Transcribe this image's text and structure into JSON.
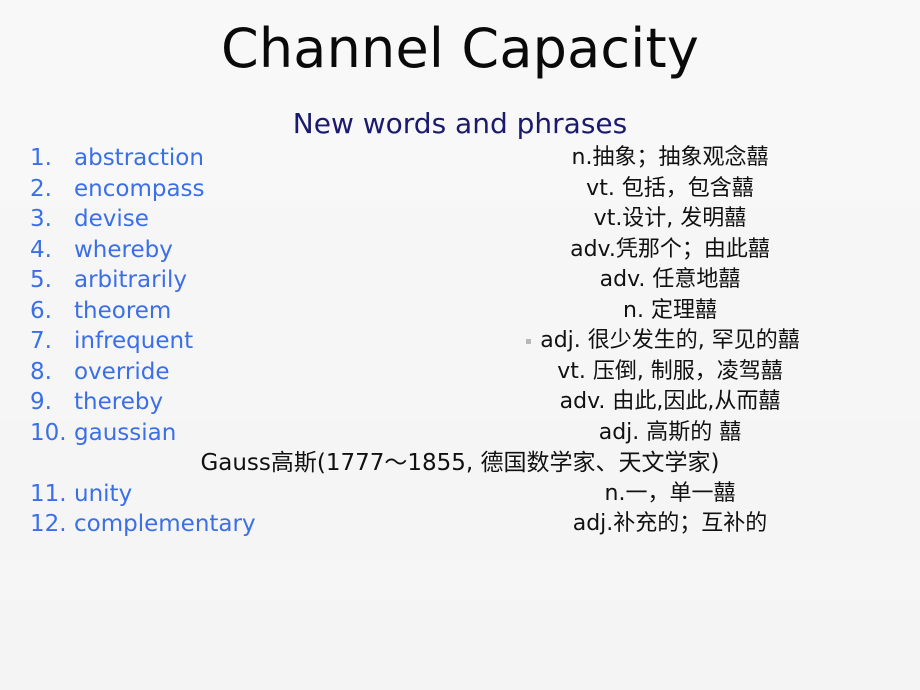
{
  "slide": {
    "title": "Channel Capacity",
    "subtitle": "New words and phrases",
    "title_color": "#0a0a0a",
    "subtitle_color": "#1a1a6e",
    "word_color": "#3b6fe8",
    "definition_color": "#111111",
    "background_color": "#f6f6f6"
  },
  "vocabulary": [
    {
      "num": "1.",
      "word": "abstraction",
      "definition": "n.抽象；抽象观念囍",
      "bullet": false
    },
    {
      "num": "2.",
      "word": "encompass",
      "definition": "vt. 包括，包含囍",
      "bullet": false
    },
    {
      "num": "3.",
      "word": "devise",
      "definition": "vt.设计, 发明囍",
      "bullet": false
    },
    {
      "num": "4.",
      "word": "whereby",
      "definition": "adv.凭那个；由此囍",
      "bullet": false
    },
    {
      "num": "5.",
      "word": "arbitrarily",
      "definition": "adv. 任意地囍",
      "bullet": false
    },
    {
      "num": "6.",
      "word": "theorem",
      "definition": "n. 定理囍",
      "bullet": false
    },
    {
      "num": "7.",
      "word": "infrequent",
      "definition": "adj. 很少发生的, 罕见的囍",
      "bullet": true
    },
    {
      "num": "8.",
      "word": "override",
      "definition": "vt. 压倒, 制服，凌驾囍",
      "bullet": false
    },
    {
      "num": "9.",
      "word": "thereby",
      "definition": "adv. 由此,因此,从而囍",
      "bullet": false
    },
    {
      "num": "10.",
      "word": "gaussian",
      "definition": "adj. 高斯的 囍",
      "bullet": false
    },
    {
      "num": "11.",
      "word": "unity",
      "definition": "n.一，单一囍",
      "bullet": false
    },
    {
      "num": "12.",
      "word": "complementary",
      "definition": "adj.补充的；互补的",
      "bullet": false
    }
  ],
  "gauss_note": {
    "text": "Gauss高斯(1777～1855, 德国数学家、天文学家)",
    "after_item_index": 10
  }
}
